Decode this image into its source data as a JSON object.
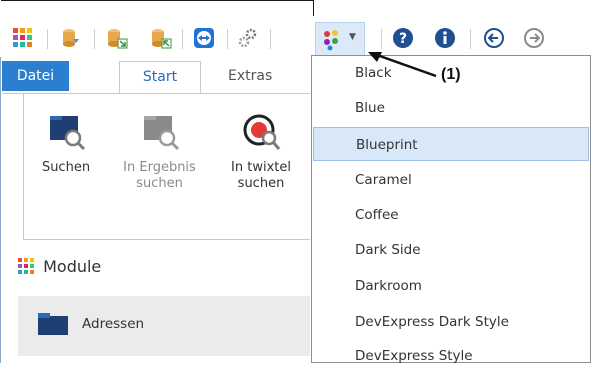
{
  "ribbon": {
    "tabs": [
      "Datei",
      "Start",
      "Extras"
    ],
    "buttons": [
      {
        "label": "Suchen"
      },
      {
        "label": "In Ergebnis suchen"
      },
      {
        "label": "In twixtel suchen"
      }
    ]
  },
  "module": {
    "header": "Module",
    "items": [
      "Adressen"
    ]
  },
  "skin_menu": {
    "items": [
      "Black",
      "Blue",
      "Blueprint",
      "Caramel",
      "Coffee",
      "Dark Side",
      "Darkroom",
      "DevExpress Dark Style",
      "DevExpress Style"
    ],
    "selected": "Blueprint"
  },
  "annotation": {
    "label": "(1)"
  },
  "colors": {
    "accent": "#2b7fd0",
    "menu_highlight": "#d9e8f8",
    "icon_navy": "#1d3f72"
  },
  "toolbar_icons": [
    "apps-grid-icon",
    "cylinder-database-icon",
    "database-export-icon",
    "database-import-icon",
    "teamviewer-icon",
    "gear-icon",
    "palette-icon",
    "help-icon",
    "info-icon",
    "back-icon",
    "forward-icon"
  ]
}
